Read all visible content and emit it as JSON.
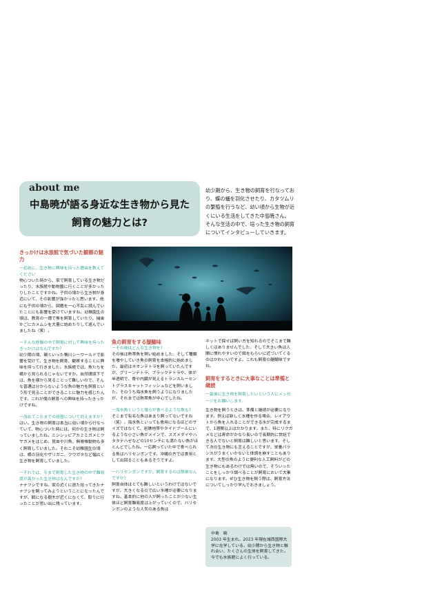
{
  "header": {
    "tag": "about me",
    "title_line1": "中島暁が語る身近な生き物から見た",
    "title_line2": "飼育の魅力とは?"
  },
  "intro": {
    "p1": "幼少期から、生き物の飼育を行なっており、蝶の蛹を羽化させたり、カタツムリの繁殖を行うなど、幼い頃から生物が近くにいる生活をしてきた中島暁さん。",
    "p2": "そんな生活の中で、培った生き物の飼育についてインタビューしていきます。"
  },
  "photo": {
    "icon": "aquarium-photo"
  },
  "column1": {
    "heading": "きっかけは水族館で気づいた観察の魅力",
    "q1": "ー初めに、生き物に興味を持った理由を教えてください",
    "a1": "物心ついた時から、家で飼育している生き物だったり、水族館や動物園に行くことが多かったりしたことですかね。子供の頃から生き物が身近にいて、その影響が強かったと思います。他にも子供の頃から、図鑑を一心不乱に読んでいたことにも影響を受けていますね。幼稚園生の頃は、教育の一環で蚕を飼育していたり、捕虫かごにカメムシを大量に詰めたりして遊んでいましたね（笑）。",
    "q2": "ーそんな経験の中で飼育に対して興味を持ったきっかけはなんですか?",
    "a2": "幼少期の頃、親といった鴨川シーワールドで影響を受けて、生き物を飼育、観察することに興味を持って行きました。水族館では、魚たちを横から見られるじゃないですか。自然環境下では、魚を横から見ることって難しいので、そんな普通は分からないような魚の魅力を飼育という形で見ることができることに魅力を感じたんです。これが僕の飼育への興味を持ったきっかけですね。",
    "q3": "ー改めてこれまでの経歴について伺えますか?",
    "a3": "はい。生き物の飼育は本当に幼い頃から行なっていて、物心ついた時には、何かの生き物は飼っていましたね。ミシシッピアカミミガメとクサガメをはじめ、昆虫や川魚、無脊椎動物も多く飼育していました。それこそ幼稚園生の頃は、蝶の羽化やザリガニ、クワガタなど幅広く生き物を飼育していました。",
    "q4": "ーそれでは、今まで飼育した生き物の中で難易度が高かった生き物はなんですか?",
    "a4": "ナナフシですね。家の近くに居た拾ってきたナナフシを飼ってみようということになったんですが、餌になる樹木が近くになくて、取りに行ったことが思い出に残っています。"
  },
  "column2": {
    "heading": "魚の飼育をする醍醐味",
    "q1": "ーその後はどんな生き物を?",
    "a1": "その後は熱帯魚を飼い始めました。そして種類を増やしていき魚の飼育を本格的に始めました。最初はネオンテトラを飼っていたんですが、グリーンテトラ、ブラックテトラや、体が半透明で、骨や内臓が見えるトランスルーセントグラスキャットフィッシュなどを飼いました。そのうち海水魚を飼うようになりましたが、それまでは熱帯魚が中心でしたね。",
    "q2": "ー海水魚というと僕らが食べるような魚も?",
    "a2": "そこまで有名な魚はあまり飼ってないですね（笑）。海水魚といっても食用になるほどのサイズではなくて、岩礁地帯やタイドプールにいるような小さい魚がメインで、スズメダイやハタタテハゼなどの10センチにも満たない魚がほとんどでしたね。一応飼っていた中で食べられる魚はハリセンボンです。沖縄の方では食用として出回ることもあるそうですよ。",
    "q3": "ーハリセンボンですか。飼育するのは簡単なんですか?",
    "a3": "飼育自体はとても難しいというわけではないですが、大きくなるので広い水槽が必要になりますね。基本的に他の人が飼ったことが少ない生体ほど飼育難易度は上がっていくので、ハリセンボンのような人気のある魚は"
  },
  "column3": {
    "a0": "ネットで探せば飼い方を知れるのでそこまで難しくはありませんでした。そして大きい魚は人間に慣れやすいので餌をもらいに近づいてくるのはかわいいですよ。これも飼育の醍醐味ですね。",
    "heading": "飼育をするときに大事なことは準備と継続",
    "q1": "ー最後に生き物を飼育したいという人にメッセージをお願いします。",
    "a1": "生き物を飼うときは、準備と継続が必要になります。例えば新しく水槽を作る場合、レイアウトから魚を入れることができる水が完成するまで、1週間以上はかかります。また、特にリクガメなどは寿命がかなり長いので長期的に世話できる人でないと飼育は難しいと思います。そして次の生き物にも言えることですが、栄養バランスがうまくいかないと体調を崩すこともあります。大型の魚のように便利な人工飼料がどの生き物にもあるわけでは無いので、そういったことをしっかり調べることが飼育において大事になります。ぜひ生き物を飼う際は、飼育方法についてしっかり学んでおきましょう。"
  },
  "profile": {
    "name": "中島　暁",
    "bio": "2003 年生まれ。2023 年現在城西国際大学に在学している。幼少期から生き物と触れ合い、たくさんの生体を飼育してきた。今でも水族館によく行っている。"
  }
}
